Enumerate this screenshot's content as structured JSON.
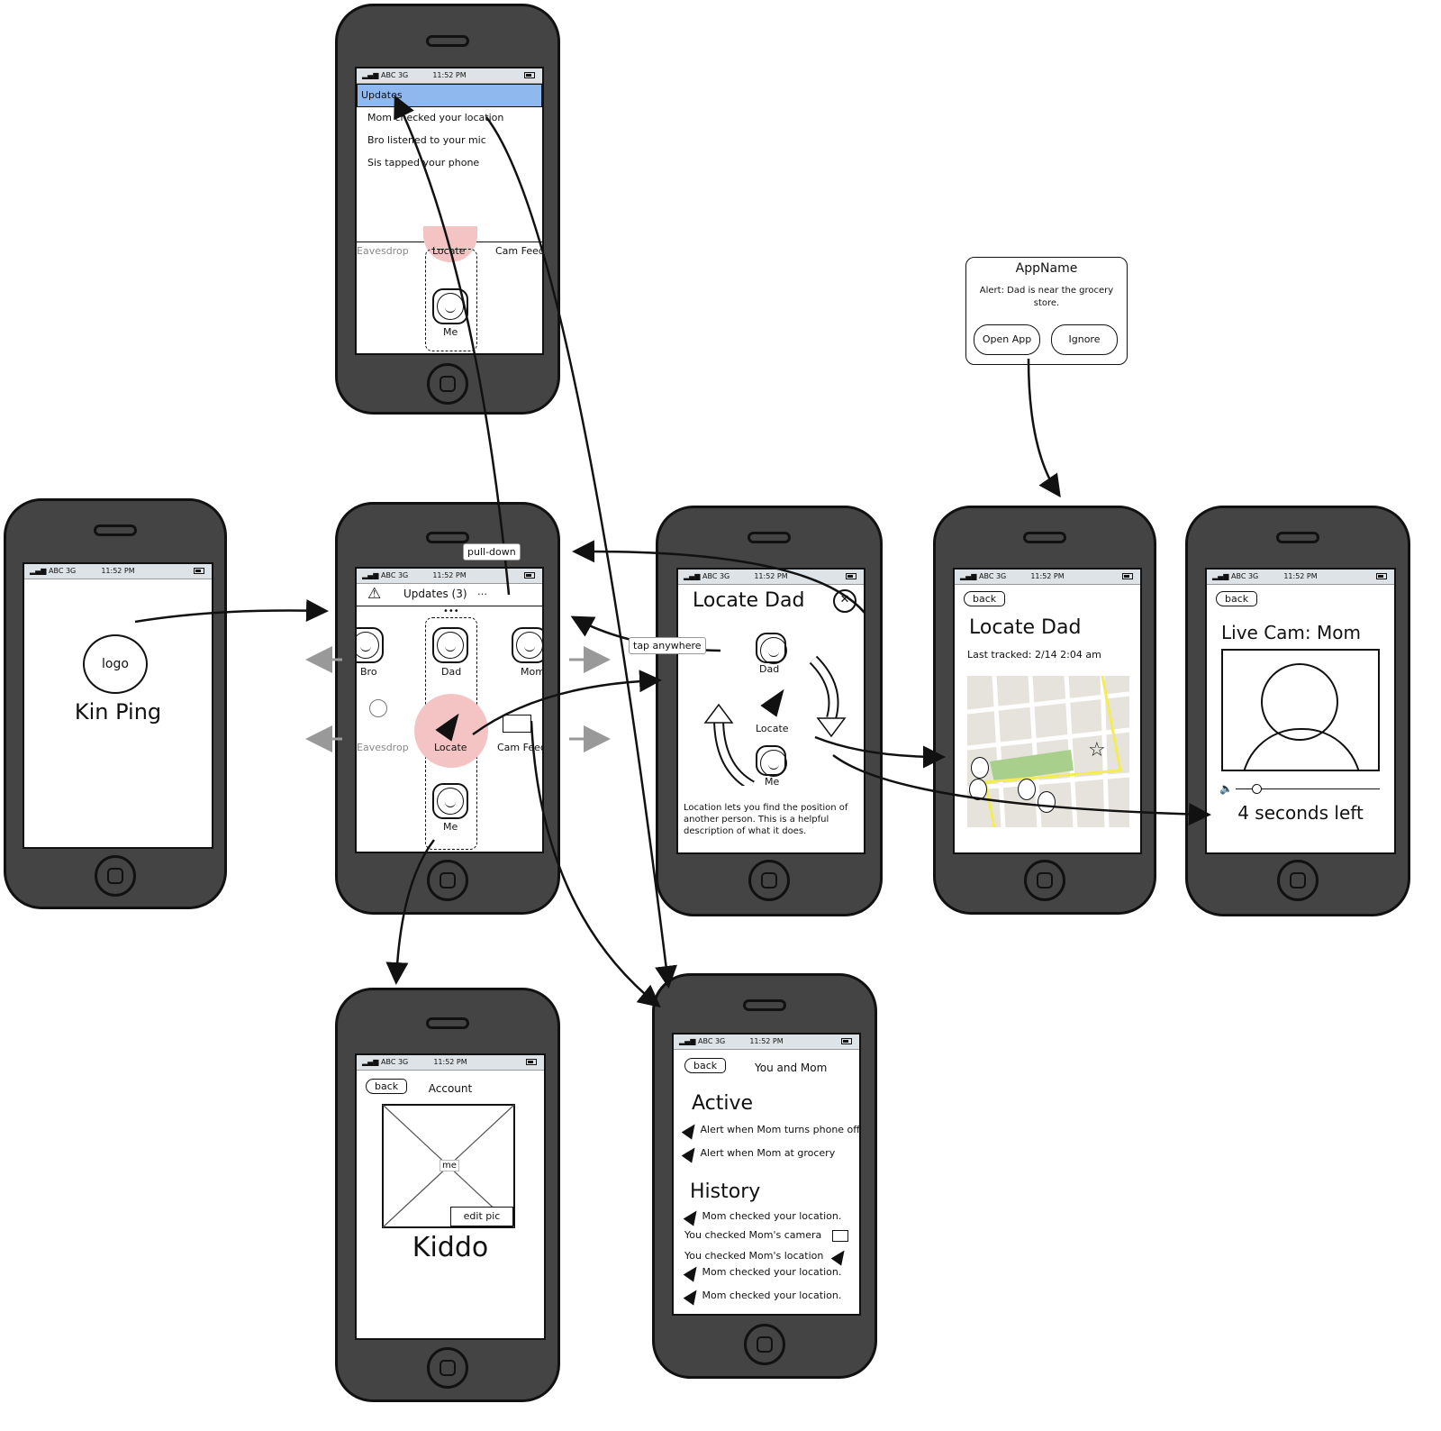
{
  "status": {
    "carrier": "ABC",
    "network": "3G",
    "time": "11:52 PM"
  },
  "splash": {
    "logo": "logo",
    "app_name": "Kin Ping"
  },
  "updates_screen": {
    "header": "Updates",
    "items": [
      "Mom checked your location",
      "Bro listened to your mic",
      "Sis tapped your phone"
    ],
    "tabs": [
      "Eavesdrop",
      "Locate",
      "Cam Feed"
    ],
    "me": "Me"
  },
  "home": {
    "updates_label": "Updates (3)",
    "people": [
      "Bro",
      "Dad",
      "Mom"
    ],
    "me": "Me",
    "actions": [
      "Eavesdrop",
      "Locate",
      "Cam Feed"
    ]
  },
  "annotations": {
    "pull_down": "pull-down",
    "tap_anywhere": "tap anywhere"
  },
  "locate_modal": {
    "title": "Locate Dad",
    "dad": "Dad",
    "locate": "Locate",
    "me": "Me",
    "description": "Location lets you find the position of another person. This is a helpful description of what it does."
  },
  "notification": {
    "app": "AppName",
    "message": "Alert: Dad is near the grocery store.",
    "open": "Open App",
    "ignore": "Ignore"
  },
  "locate_map": {
    "back": "back",
    "title": "Locate Dad",
    "last_tracked": "Last tracked: 2/14 2:04 am"
  },
  "live_cam": {
    "back": "back",
    "title": "Live Cam: Mom",
    "timer": "4 seconds left"
  },
  "account": {
    "back": "back",
    "title": "Account",
    "pic_label": "me",
    "edit": "edit pic",
    "name": "Kiddo"
  },
  "relationship": {
    "back": "back",
    "title": "You and Mom",
    "active_heading": "Active",
    "active": [
      "Alert when Mom turns phone off",
      "Alert when Mom at grocery"
    ],
    "history_heading": "History",
    "history": [
      "Mom checked your location.",
      "You checked Mom's camera",
      "You checked Mom's location",
      "Mom checked your location.",
      "Mom checked your location."
    ]
  },
  "colors": {
    "phone": "#444444",
    "highlight": "#8fb8ee",
    "locate_circle": "#f4c4c4",
    "map_park": "#a8cf8c",
    "map_road": "#f5ec54"
  }
}
